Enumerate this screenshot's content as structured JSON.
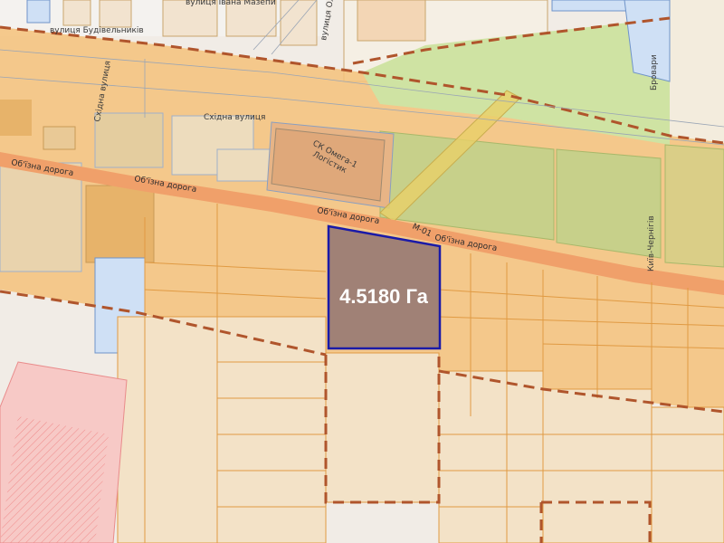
{
  "map": {
    "area_label": "4.5180 Га",
    "streets": {
      "budivelnykiv": "вулиця Будівельників",
      "ivana_mazepy": "вулиця Івана Мазепи",
      "oliinyka": "вулиця Олійника",
      "skhidna_vertical": "Східна вулиця",
      "skhidna": "Східна вулиця",
      "brovary": "Бровари",
      "obizna_1": "Об'їзна дорога",
      "obizna_2": "Об'їзна дорога",
      "obizna_3": "Об'їзна дорога",
      "obizna_4": "Об'їзна дорога",
      "m01": "М-01",
      "small_right": "Київ-Чернігів"
    },
    "places": {
      "omega": "СК Омега-1",
      "omega_sub": "Логістик"
    },
    "colors": {
      "selected_plot_fill": "#a08176",
      "selected_plot_border": "#1a1aa8",
      "zone_orange": "#f5c27a",
      "zone_light": "#f3e2c7",
      "zone_green": "#cfe3a3",
      "zone_pink": "#f7c9c6",
      "road": "#f0a06a",
      "boundary": "#b0552c"
    }
  }
}
